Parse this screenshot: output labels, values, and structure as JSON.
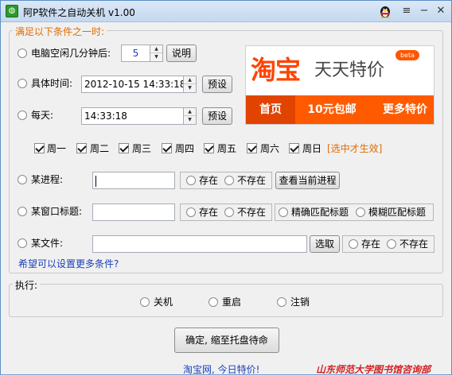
{
  "window": {
    "title": "阿P软件之自动关机 v1.00",
    "app_icon_glyph": "◍",
    "menu_glyph": "≡",
    "minimize_glyph": "−",
    "close_glyph": "✕"
  },
  "conditions": {
    "legend": "满足以下条件之一时:",
    "idle": {
      "label": "电脑空闲几分钟后:",
      "value": "5",
      "button": "说明"
    },
    "datetime": {
      "label": "具体时间:",
      "value": "2012-10-15 14:33:18",
      "button": "预设"
    },
    "daily": {
      "label": "每天:",
      "value": "14:33:18",
      "button": "预设"
    },
    "weekdays": [
      "周一",
      "周二",
      "周三",
      "周四",
      "周五",
      "周六",
      "周日"
    ],
    "weekday_note": "[选中才生效]",
    "process": {
      "label": "某进程:",
      "exists": "存在",
      "not_exists": "不存在",
      "button": "查看当前进程"
    },
    "window_title": {
      "label": "某窗口标题:",
      "exists": "存在",
      "not_exists": "不存在",
      "exact": "精确匹配标题",
      "fuzzy": "模糊匹配标题"
    },
    "file": {
      "label": "某文件:",
      "button": "选取",
      "exists": "存在",
      "not_exists": "不存在"
    },
    "more_link": "希望可以设置更多条件?"
  },
  "ad": {
    "logo": "淘宝",
    "slogan": "天天特价",
    "badge": "beta",
    "tabs": [
      "首页",
      "10元包邮",
      "更多特价"
    ]
  },
  "execute": {
    "legend": "执行:",
    "options": [
      "关机",
      "重启",
      "注销"
    ]
  },
  "confirm_button": "确定, 缩至托盘待命",
  "footer": {
    "left": "淘宝网, 今日特价!",
    "right": "山东师范大学图书馆咨询部"
  },
  "colors": {
    "accent_orange": "#ff4400",
    "link_blue": "#1a3fb8",
    "legend_orange": "#e06c00",
    "footer_red": "#d42020"
  }
}
